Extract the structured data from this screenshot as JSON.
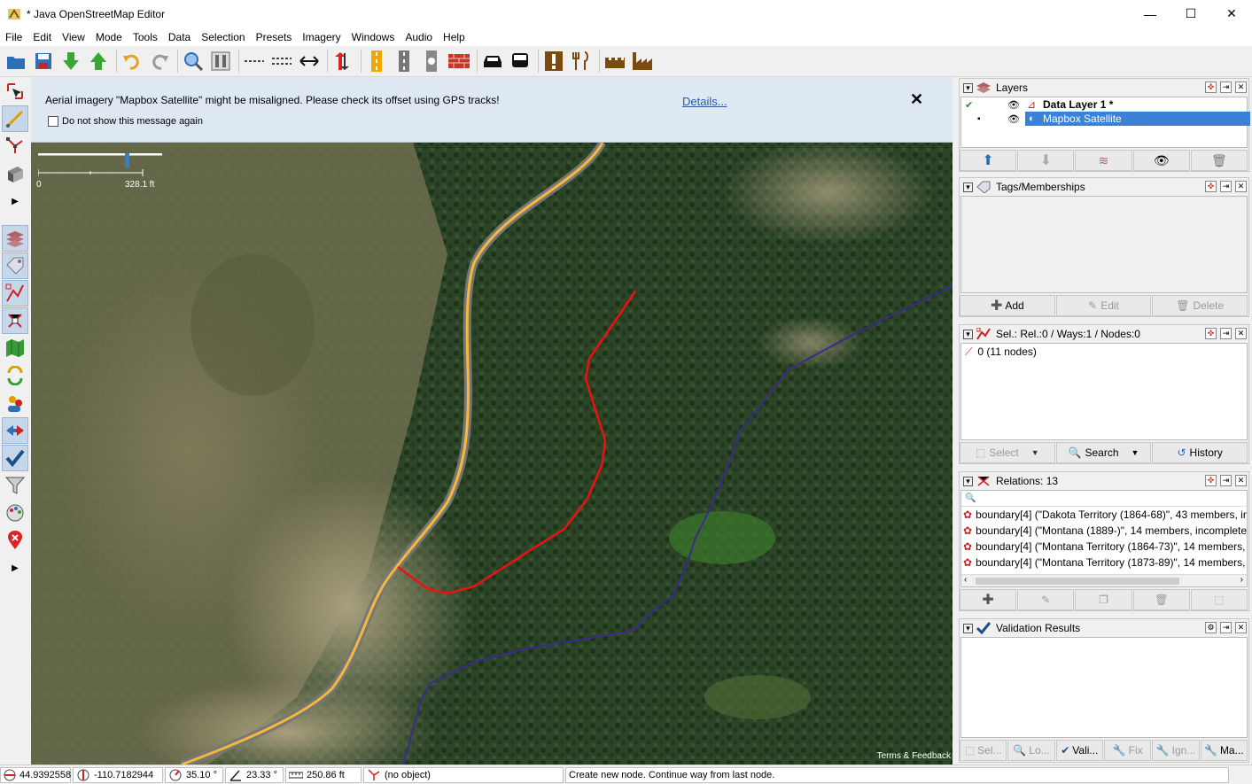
{
  "window": {
    "title": "* Java OpenStreetMap Editor",
    "minimize": "—",
    "maximize": "☐",
    "close": "✕"
  },
  "menu": [
    "File",
    "Edit",
    "View",
    "Mode",
    "Tools",
    "Data",
    "Selection",
    "Presets",
    "Imagery",
    "Windows",
    "Audio",
    "Help"
  ],
  "notice": {
    "message": "Aerial imagery \"Mapbox Satellite\" might be misaligned. Please check its offset using GPS tracks!",
    "details": "Details...",
    "close": "✕",
    "checkbox_label": "Do not show this message again"
  },
  "scale": {
    "zero": "0",
    "max": "328.1 ft"
  },
  "terms": "Terms & Feedback",
  "layers": {
    "title": "Layers",
    "items": [
      {
        "name": "Data Layer 1 *"
      },
      {
        "name": "Mapbox Satellite"
      }
    ]
  },
  "tags": {
    "title": "Tags/Memberships",
    "add": "Add",
    "edit": "Edit",
    "delete": "Delete"
  },
  "selection": {
    "title": "Sel.: Rel.:0 / Ways:1 / Nodes:0",
    "item": "0 (11 nodes)",
    "select": "Select",
    "search": "Search",
    "history": "History"
  },
  "relations": {
    "title": "Relations: 13",
    "items": [
      "boundary[4] (\"Dakota Territory (1864-68)\", 43 members, inc",
      "boundary[4] (\"Montana (1889-)\", 14 members, incomplete)",
      "boundary[4] (\"Montana Territory (1864-73)\", 14 members, i",
      "boundary[4] (\"Montana Territory (1873-89)\", 14 members, i"
    ]
  },
  "validation": {
    "title": "Validation Results",
    "tabs": [
      "Sel...",
      "Lo...",
      "Vali...",
      "Fix",
      "Ign...",
      "Ma..."
    ]
  },
  "status": {
    "lat": "44.9392558",
    "lon": "-110.7182944",
    "heading": "35.10 °",
    "angle": "23.33 °",
    "length": "250.86 ft",
    "object": "(no object)",
    "help": "Create new node. Continue way from last node."
  }
}
